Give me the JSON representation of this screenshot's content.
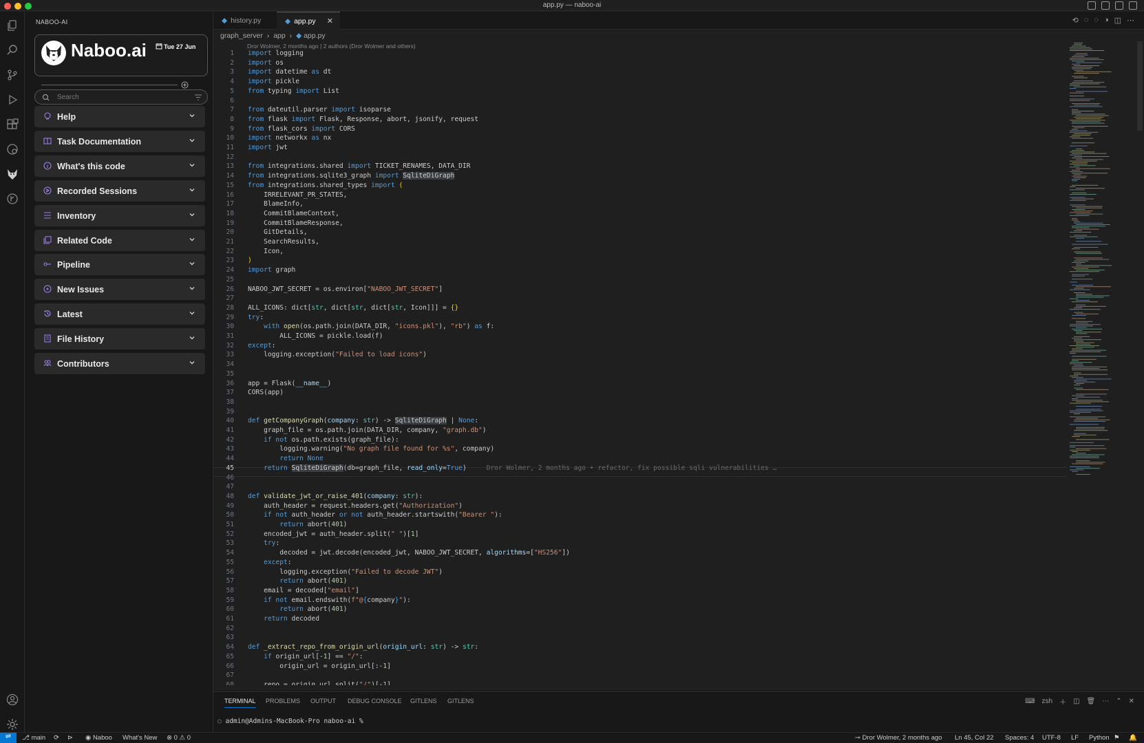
{
  "window": {
    "title": "app.py — naboo-ai"
  },
  "sidebar": {
    "title": "NABOO-AI",
    "brand": "Naboo.ai",
    "date": "Tue 27 Jun",
    "search_placeholder": "Search",
    "panels": [
      {
        "label": "Help",
        "icon": "lightbulb-icon"
      },
      {
        "label": "Task Documentation",
        "icon": "book-icon"
      },
      {
        "label": "What's this code",
        "icon": "info-icon"
      },
      {
        "label": "Recorded Sessions",
        "icon": "play-circle-icon"
      },
      {
        "label": "Inventory",
        "icon": "list-icon"
      },
      {
        "label": "Related Code",
        "icon": "copy-icon"
      },
      {
        "label": "Pipeline",
        "icon": "pipeline-icon"
      },
      {
        "label": "New Issues",
        "icon": "issue-icon"
      },
      {
        "label": "Latest",
        "icon": "history-icon"
      },
      {
        "label": "File History",
        "icon": "file-history-icon"
      },
      {
        "label": "Contributors",
        "icon": "people-icon"
      }
    ]
  },
  "editor": {
    "tabs": [
      {
        "label": "history.py",
        "active": false
      },
      {
        "label": "app.py",
        "active": true
      }
    ],
    "breadcrumb": [
      "graph_server",
      "app",
      "app.py"
    ],
    "blame_header": "Dror Wolmer, 2 months ago | 2 authors (Dror Wolmer and others)",
    "inline_blame": "Dror Wolmer, 2 months ago • refactor, fix possible sqli vulnerabilities …",
    "current_line": 45
  },
  "panel": {
    "tabs": [
      "TERMINAL",
      "PROBLEMS",
      "OUTPUT",
      "DEBUG CONSOLE",
      "GITLENS",
      "GITLENS"
    ],
    "active_tab": "TERMINAL",
    "shell": "zsh",
    "prompt": "admin@Admins-MacBook-Pro naboo-ai %"
  },
  "statusbar": {
    "branch": "main",
    "naboo": "Naboo",
    "whats_new": "What's New",
    "errors": "0",
    "warnings": "0",
    "blame": "Dror Wolmer, 2 months ago",
    "position": "Ln 45, Col 22",
    "spaces": "Spaces: 4",
    "encoding": "UTF-8",
    "eol": "LF",
    "language": "Python"
  },
  "colors": {
    "accent": "#0078d4",
    "background": "#1f1f1f",
    "sidebar": "#181818"
  }
}
